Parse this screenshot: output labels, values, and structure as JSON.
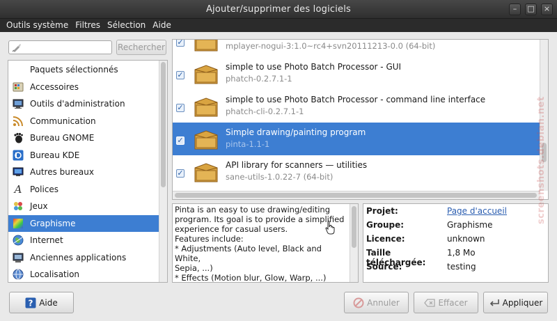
{
  "window": {
    "title": "Ajouter/supprimer des logiciels"
  },
  "menubar": [
    "Outils système",
    "Filtres",
    "Sélection",
    "Aide"
  ],
  "search": {
    "value": "",
    "button_label": "Rechercher"
  },
  "categories": [
    {
      "label": "Paquets sélectionnés",
      "icon": "selected-packages-icon"
    },
    {
      "label": "Accessoires",
      "icon": "accessories-icon"
    },
    {
      "label": "Outils d'administration",
      "icon": "admin-tools-icon"
    },
    {
      "label": "Communication",
      "icon": "communication-icon"
    },
    {
      "label": "Bureau GNOME",
      "icon": "gnome-icon"
    },
    {
      "label": "Bureau KDE",
      "icon": "kde-icon"
    },
    {
      "label": "Autres bureaux",
      "icon": "other-desktops-icon"
    },
    {
      "label": "Polices",
      "icon": "fonts-icon"
    },
    {
      "label": "Jeux",
      "icon": "games-icon"
    },
    {
      "label": "Graphisme",
      "icon": "graphics-icon",
      "selected": true
    },
    {
      "label": "Internet",
      "icon": "internet-icon"
    },
    {
      "label": "Anciennes applications",
      "icon": "legacy-apps-icon"
    },
    {
      "label": "Localisation",
      "icon": "localisation-icon"
    }
  ],
  "packages": [
    {
      "name": "",
      "version": "mplayer-nogui-3:1.0~rc4+svn20111213-0.0 (64-bit)",
      "checked": true
    },
    {
      "name": "simple to use Photo Batch Processor - GUI",
      "version": "phatch-0.2.7.1-1",
      "checked": true
    },
    {
      "name": "simple to use Photo Batch Processor - command line interface",
      "version": "phatch-cli-0.2.7.1-1",
      "checked": true
    },
    {
      "name": "Simple drawing/painting program",
      "version": "pinta-1.1-1",
      "checked": true,
      "selected": true
    },
    {
      "name": "API library for scanners — utilities",
      "version": "sane-utils-1.0.22-7 (64-bit)",
      "checked": true
    }
  ],
  "description": "Pinta is an easy to use drawing/editing\nprogram. Its goal is to provide a simplified\nexperience for casual users.\nFeatures include:\n* Adjustments (Auto level, Black and White,\nSepia, ...)\n* Effects (Motion blur, Glow, Warp, ...)\n* Multiple layers",
  "info": {
    "projet_label": "Projet:",
    "projet_value": "Page d'accueil",
    "groupe_label": "Groupe:",
    "groupe_value": "Graphisme",
    "licence_label": "Licence:",
    "licence_value": "unknown",
    "taille_label": "Taille téléchargée:",
    "taille_value": "1,8 Mo",
    "source_label": "Source:",
    "source_value": "testing"
  },
  "buttons": {
    "aide": "Aide",
    "annuler": "Annuler",
    "effacer": "Effacer",
    "appliquer": "Appliquer"
  },
  "watermark": "screenshots.debian.net"
}
